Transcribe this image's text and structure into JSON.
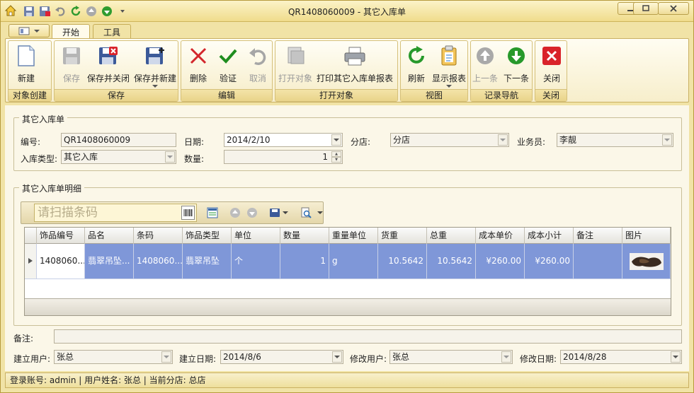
{
  "window": {
    "title": "QR1408060009 - 其它入库单"
  },
  "ribbon_tabs": [
    "开始",
    "工具"
  ],
  "ribbon": {
    "groups": [
      {
        "label": "对象创建",
        "buttons": [
          {
            "label": "新建",
            "enabled": true
          }
        ]
      },
      {
        "label": "保存",
        "buttons": [
          {
            "label": "保存",
            "enabled": false
          },
          {
            "label": "保存并关闭",
            "enabled": true
          },
          {
            "label": "保存并新建",
            "enabled": true
          }
        ]
      },
      {
        "label": "编辑",
        "buttons": [
          {
            "label": "删除",
            "enabled": true
          },
          {
            "label": "验证",
            "enabled": true
          },
          {
            "label": "取消",
            "enabled": false
          }
        ]
      },
      {
        "label": "打开对象",
        "buttons": [
          {
            "label": "打开对象",
            "enabled": false
          },
          {
            "label": "打印其它入库单报表",
            "enabled": true
          }
        ]
      },
      {
        "label": "视图",
        "buttons": [
          {
            "label": "刷新",
            "enabled": true
          },
          {
            "label": "显示报表",
            "enabled": true
          }
        ]
      },
      {
        "label": "记录导航",
        "buttons": [
          {
            "label": "上一条",
            "enabled": false
          },
          {
            "label": "下一条",
            "enabled": true
          }
        ]
      },
      {
        "label": "关闭",
        "buttons": [
          {
            "label": "关闭",
            "enabled": true
          }
        ]
      }
    ]
  },
  "header_section": {
    "title": "其它入库单",
    "fields": {
      "code_label": "编号:",
      "code_value": "QR1408060009",
      "date_label": "日期:",
      "date_value": "2014/2/10",
      "branch_label": "分店:",
      "branch_value": "分店",
      "salesman_label": "业务员:",
      "salesman_value": "李靓",
      "type_label": "入库类型:",
      "type_value": "其它入库",
      "qty_label": "数量:",
      "qty_value": "1"
    }
  },
  "detail_section": {
    "title": "其它入库单明细",
    "scan_placeholder": "请扫描条码",
    "columns": [
      "饰品编号",
      "品名",
      "条码",
      "饰品类型",
      "单位",
      "数量",
      "重量单位",
      "货重",
      "总重",
      "成本单价",
      "成本小计",
      "备注",
      "图片"
    ],
    "rows": [
      [
        "1408060...",
        "翡翠吊坠...",
        "1408060...",
        "翡翠吊坠",
        "个",
        "1",
        "g",
        "10.5642",
        "10.5642",
        "¥260.00",
        "¥260.00",
        "",
        ""
      ]
    ]
  },
  "bottom": {
    "remark_label": "备注:",
    "remark_value": "",
    "creator_label": "建立用户:",
    "creator_value": "张总",
    "created_label": "建立日期:",
    "created_value": "2014/8/6",
    "modifier_label": "修改用户:",
    "modifier_value": "张总",
    "modified_label": "修改日期:",
    "modified_value": "2014/8/28"
  },
  "status_bar": {
    "text": "登录账号: admin | 用户姓名: 张总 | 当前分店: 总店"
  },
  "colors": {
    "accent": "#f1e3a6",
    "selected_row": "#7f97d8"
  }
}
